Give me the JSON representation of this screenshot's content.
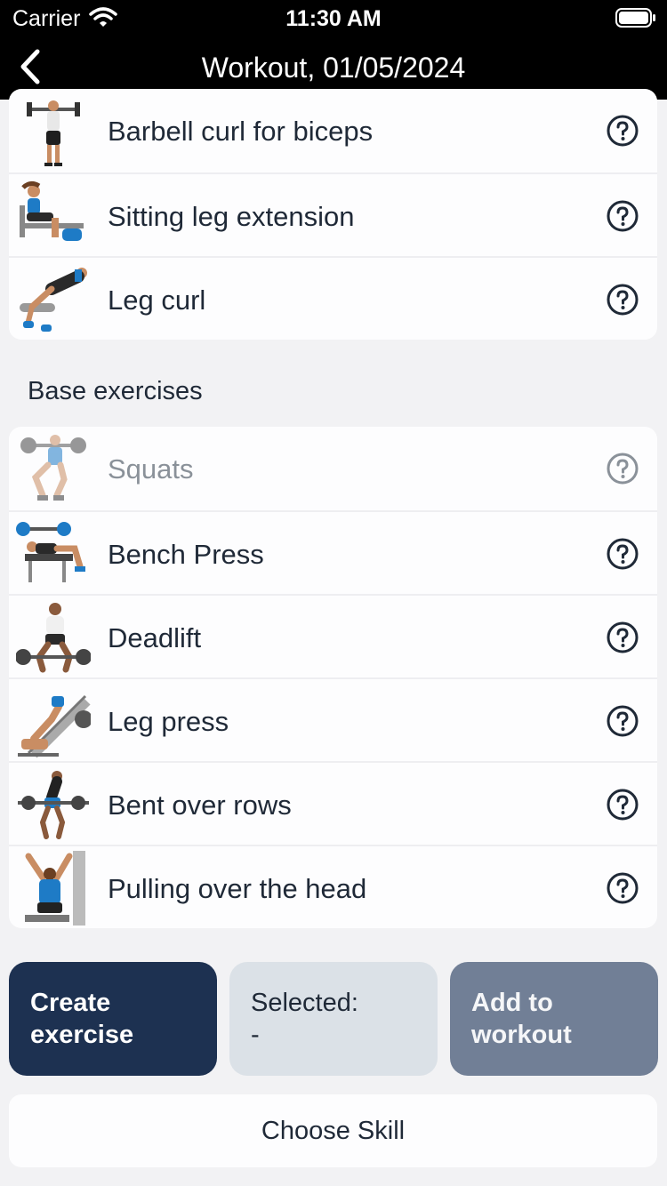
{
  "status_bar": {
    "carrier": "Carrier",
    "time": "11:30 AM"
  },
  "nav": {
    "title": "Workout, 01/05/2024"
  },
  "top_exercises": [
    {
      "label": "Barbell curl for biceps",
      "icon": "barbell-curl-figure"
    },
    {
      "label": "Sitting leg extension",
      "icon": "leg-extension-figure"
    },
    {
      "label": "Leg curl",
      "icon": "leg-curl-figure"
    }
  ],
  "base_section": {
    "title": "Base exercises",
    "items": [
      {
        "label": "Squats",
        "icon": "squats-figure",
        "disabled": true
      },
      {
        "label": "Bench Press",
        "icon": "bench-press-figure"
      },
      {
        "label": "Deadlift",
        "icon": "deadlift-figure"
      },
      {
        "label": "Leg press",
        "icon": "leg-press-figure"
      },
      {
        "label": "Bent over rows",
        "icon": "bent-over-rows-figure"
      },
      {
        "label": "Pulling over the head",
        "icon": "pulling-over-head-figure"
      }
    ]
  },
  "actions": {
    "create": {
      "line1": "Create",
      "line2": "exercise"
    },
    "selected": {
      "line1": "Selected:",
      "line2": "-"
    },
    "add": {
      "line1": "Add to",
      "line2": "workout"
    },
    "choose_skill": "Choose Skill"
  },
  "colors": {
    "header_bg": "#000000",
    "primary": "#1d3151",
    "secondary": "#dbe1e7",
    "muted_button": "#717f96",
    "disabled_text": "#8a9199"
  }
}
